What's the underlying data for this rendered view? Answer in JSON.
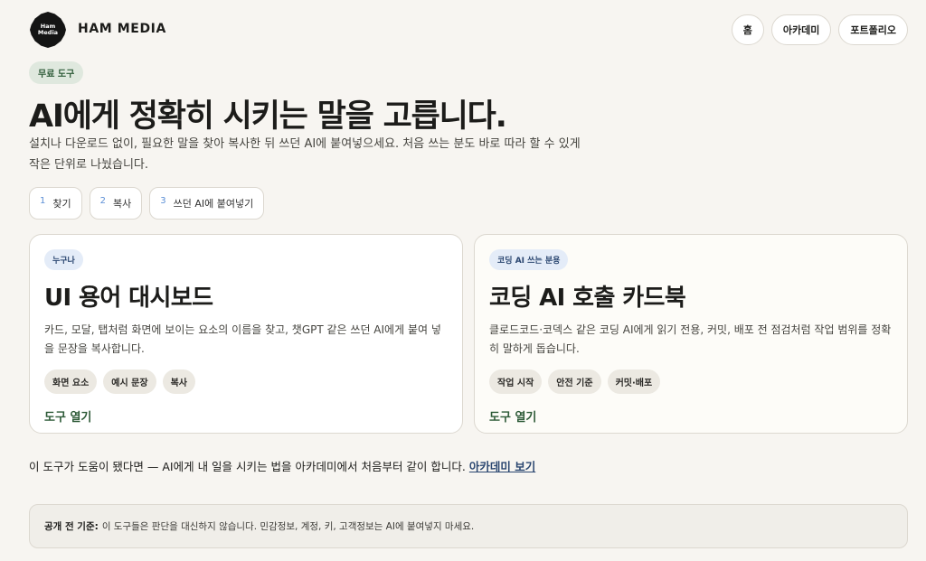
{
  "header": {
    "logo_text": "Ham Media",
    "brand": "HAM MEDIA",
    "nav": [
      "홈",
      "아카데미",
      "포트폴리오"
    ]
  },
  "hero": {
    "badge": "무료 도구",
    "title": "AI에게 정확히 시키는 말을 고릅니다.",
    "description": "설치나 다운로드 없이, 필요한 말을 찾아 복사한 뒤 쓰던 AI에 붙여넣으세요. 처음 쓰는 분도 바로 따라 할 수 있게 작은 단위로 나눴습니다."
  },
  "steps": [
    {
      "num": "1",
      "label": "찾기"
    },
    {
      "num": "2",
      "label": "복사"
    },
    {
      "num": "3",
      "label": "쓰던 AI에 붙여넣기"
    }
  ],
  "cards": [
    {
      "audience": "누구나",
      "title": "UI 용어 대시보드",
      "description": "카드, 모달, 탭처럼 화면에 보이는 요소의 이름을 찾고, 챗GPT 같은 쓰던 AI에게 붙여 넣을 문장을 복사합니다.",
      "tags": [
        "화면 요소",
        "예시 문장",
        "복사"
      ],
      "link": "도구 열기"
    },
    {
      "audience": "코딩 AI 쓰는 분용",
      "title": "코딩 AI 호출 카드북",
      "description": "클로드코드·코덱스 같은 코딩 AI에게 읽기 전용, 커밋, 배포 전 점검처럼 작업 범위를 정확히 말하게 돕습니다.",
      "tags": [
        "작업 시작",
        "안전 기준",
        "커밋·배포"
      ],
      "link": "도구 열기"
    }
  ],
  "footer": {
    "text": "이 도구가 도움이 됐다면 — AI에게 내 일을 시키는 법을 아카데미에서 처음부터 같이 합니다.",
    "link": "아카데미 보기"
  },
  "notice": {
    "label": "공개 전 기준:",
    "text": "이 도구들은 판단을 대신하지 않습니다. 민감정보, 계정, 키, 고객정보는 AI에 붙여넣지 마세요."
  }
}
